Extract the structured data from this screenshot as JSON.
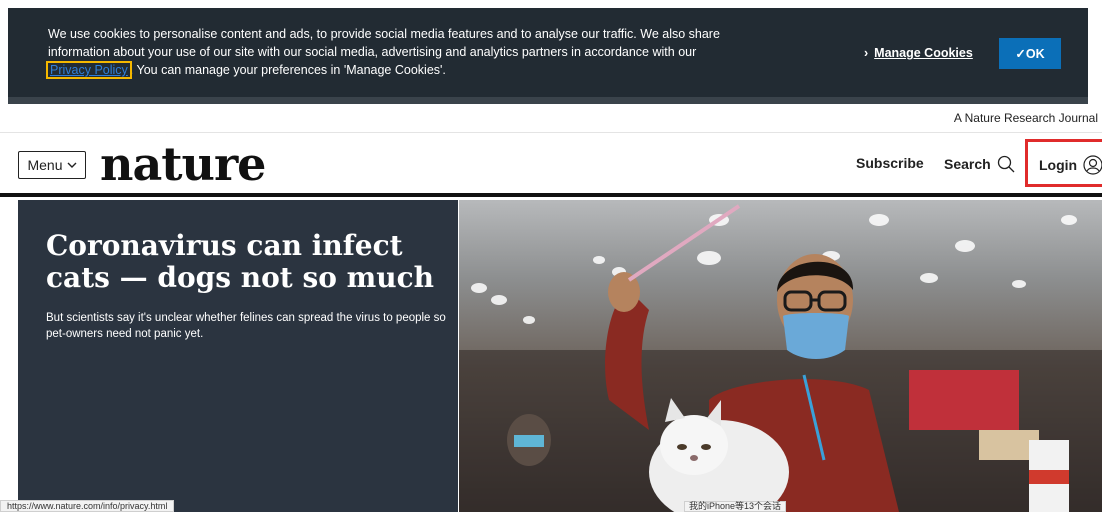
{
  "cookie_banner": {
    "text_part1": "We use cookies to personalise content and ads, to provide social media features and to analyse our traffic. We also share information about your use of our site with our social media, advertising and analytics partners in accordance with our ",
    "privacy_link": "Privacy Policy",
    "text_part2": ". You can manage your preferences in 'Manage Cookies'.",
    "manage_chevron": "›",
    "manage_label": "Manage Cookies",
    "ok_label": "✓OK",
    "colors": {
      "background": "#222b33",
      "ok_button": "#0b6fb8",
      "focus_outline": "#f5b800"
    }
  },
  "header": {
    "journal_tagline": "A Nature Research Journal",
    "menu_label": "Menu",
    "menu_icon": "chevron-down-icon",
    "logo": "nature",
    "subscribe_label": "Subscribe",
    "search_label": "Search",
    "search_icon": "search-icon",
    "login_label": "Login",
    "login_icon": "user-icon",
    "highlight_color": "#e02b2b"
  },
  "hero": {
    "title": "Coronavirus can infect cats — dogs not so much",
    "description": "But scientists say it's unclear whether felines can spread the virus to people so pet-owners need not panic yet.",
    "panel_color": "#2b3440"
  },
  "status_bar": {
    "url": "https://www.nature.com/info/privacy.html",
    "tooltip": "我的iPhone等13个会话"
  }
}
